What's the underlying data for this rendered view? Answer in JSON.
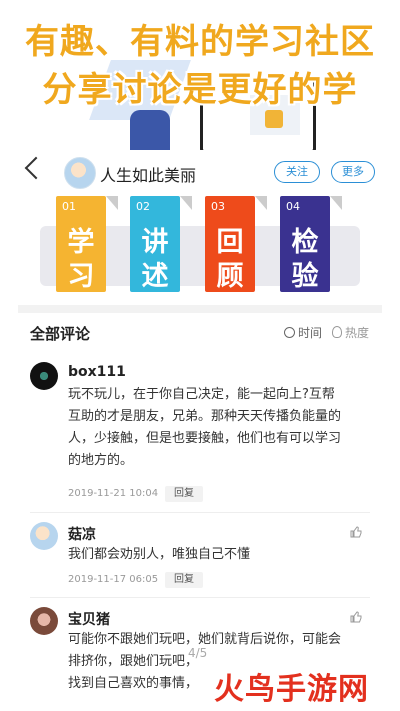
{
  "banner": {
    "line1": "有趣、有料的学习社区",
    "line2": "分享讨论是更好的学"
  },
  "profile": {
    "name": "人生如此美丽",
    "follow_label": "关注",
    "more_label": "更多"
  },
  "cards": [
    {
      "num": "01",
      "c1": "学",
      "c2": "习",
      "color": "#f5b431"
    },
    {
      "num": "02",
      "c1": "讲",
      "c2": "述",
      "color": "#33b7dc"
    },
    {
      "num": "03",
      "c1": "回",
      "c2": "顾",
      "color": "#ee4b1b"
    },
    {
      "num": "04",
      "c1": "检",
      "c2": "验",
      "color": "#3a3290"
    }
  ],
  "comments_section": {
    "title": "全部评论",
    "sort_time": "时间",
    "sort_hot": "热度"
  },
  "comments": [
    {
      "name": "box111",
      "lines": [
        "玩不玩儿，在于你自己决定，能一起向上?互帮",
        "互助的才是朋友，兄弟。那种天天传播负能量的",
        "人，少接触，但是也要接触，他们也有可以学习",
        "的地方的。"
      ],
      "date": "2019-11-21 10:04",
      "reply": "回复"
    },
    {
      "name": "菇凉",
      "lines": [
        "我们都会劝别人，唯独自己不懂"
      ],
      "date": "2019-11-17 06:05",
      "reply": "回复"
    },
    {
      "name": "宝贝猪",
      "lines": [
        "可能你不跟她们玩吧，她们就背后说你，可能会",
        "排挤你，跟她们玩吧，",
        "找到自己喜欢的事情，"
      ]
    }
  ],
  "pager": "4/5",
  "watermark": "火鸟手游网"
}
